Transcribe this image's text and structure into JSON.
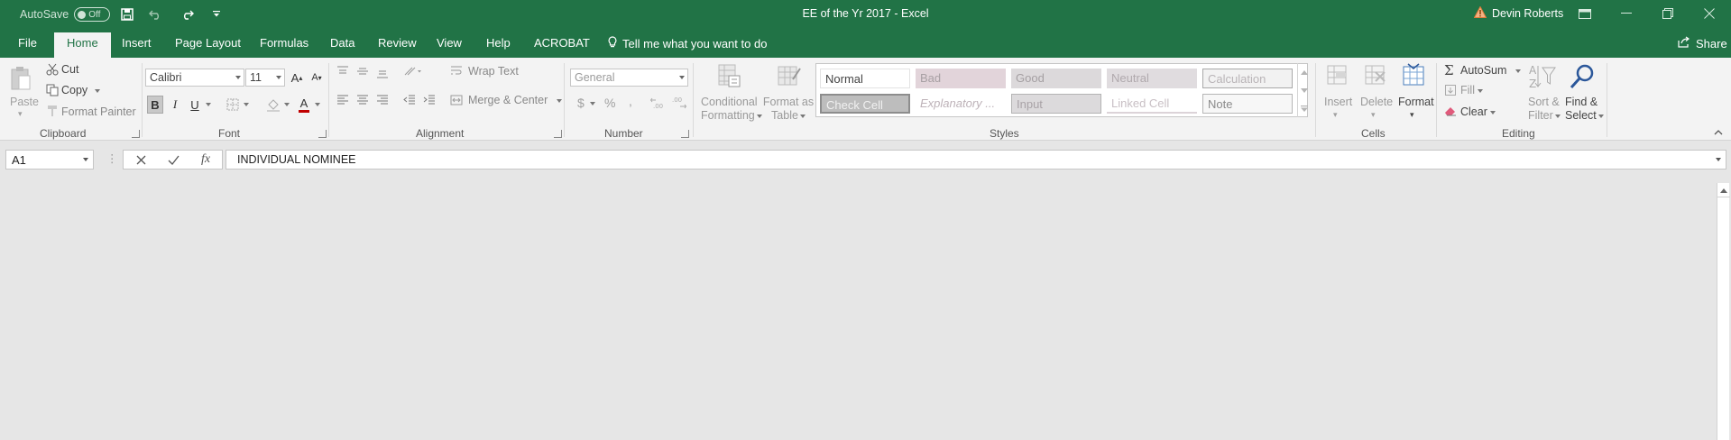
{
  "titlebar": {
    "autosave_label": "AutoSave",
    "autosave_state": "Off",
    "window_title": "EE of the Yr 2017  -  Excel",
    "user_name": "Devin Roberts"
  },
  "tabs": [
    "File",
    "Home",
    "Insert",
    "Page Layout",
    "Formulas",
    "Data",
    "Review",
    "View",
    "Help",
    "ACROBAT"
  ],
  "tell_me": "Tell me what you want to do",
  "share": "Share",
  "clipboard": {
    "paste": "Paste",
    "cut": "Cut",
    "copy": "Copy",
    "format_painter": "Format Painter",
    "label": "Clipboard"
  },
  "font": {
    "family": "Calibri",
    "size": "11",
    "bold": "B",
    "italic": "I",
    "underline": "U",
    "grow": "A",
    "shrink": "A",
    "color_glyph": "A",
    "label": "Font",
    "accent_color": "#c00000"
  },
  "alignment": {
    "wrap_text": "Wrap Text",
    "merge_center": "Merge & Center",
    "label": "Alignment"
  },
  "number": {
    "format": "General",
    "currency": "$",
    "percent": "%",
    "comma": ",",
    "label": "Number"
  },
  "styles": {
    "conditional_1": "Conditional",
    "conditional_2": "Formatting",
    "format_table_1": "Format as",
    "format_table_2": "Table",
    "label": "Styles",
    "cells": [
      {
        "text": "Normal"
      },
      {
        "text": "Bad"
      },
      {
        "text": "Good"
      },
      {
        "text": "Neutral"
      },
      {
        "text": "Calculation"
      },
      {
        "text": "Check Cell"
      },
      {
        "text": "Explanatory ..."
      },
      {
        "text": "Input"
      },
      {
        "text": "Linked Cell"
      },
      {
        "text": "Note"
      }
    ]
  },
  "cells": {
    "insert": "Insert",
    "delete": "Delete",
    "format": "Format",
    "label": "Cells"
  },
  "editing": {
    "autosum": "AutoSum",
    "fill": "Fill",
    "clear": "Clear",
    "sort_1": "Sort &",
    "sort_2": "Filter",
    "find_1": "Find &",
    "find_2": "Select",
    "label": "Editing"
  },
  "formula_bar": {
    "name_box": "A1",
    "fx": "fx",
    "content": "INDIVIDUAL NOMINEE"
  },
  "colors": {
    "excel_green": "#217346",
    "ribbon_bg": "#f3f3f3",
    "workspace_bg": "#e6e6e6"
  }
}
